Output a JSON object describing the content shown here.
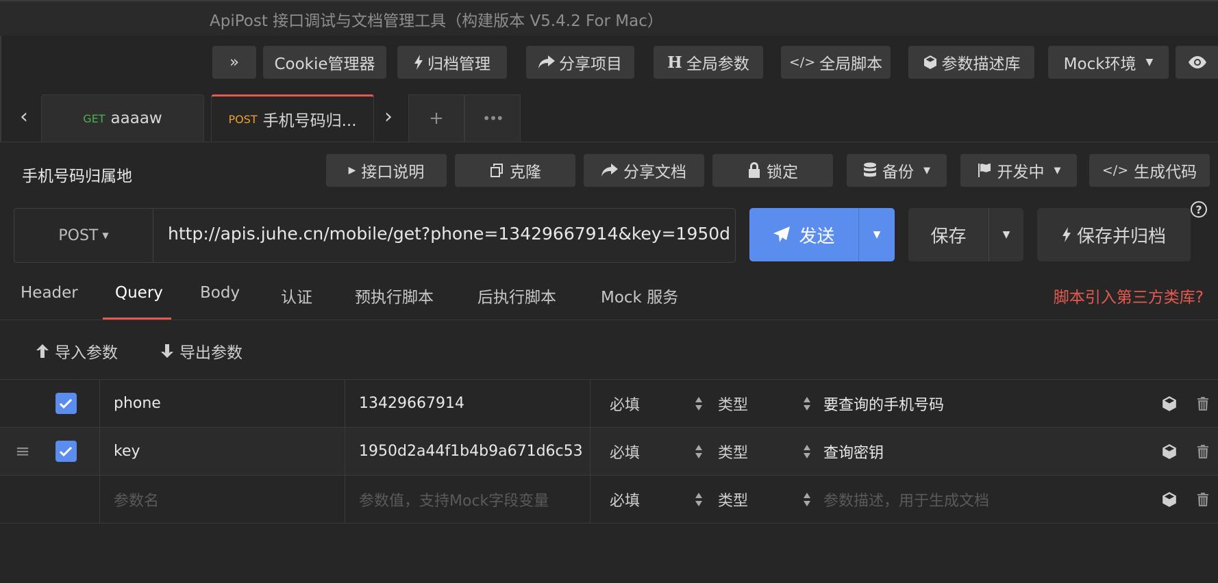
{
  "window": {
    "title": "ApiPost 接口调试与文档管理工具（构建版本 V5.4.2 For Mac）"
  },
  "toolbar": {
    "collapse_label": "»",
    "cookie_label": "Cookie管理器",
    "archive_label": "归档管理",
    "share_project_label": "分享项目",
    "global_params_label": "全局参数",
    "global_script_label": "全局脚本",
    "param_desc_label": "参数描述库",
    "mock_env_label": "Mock环境"
  },
  "tabs": [
    {
      "method": "GET",
      "name": "aaaaw",
      "method_color": "#4caf50"
    },
    {
      "method": "POST",
      "name": "手机号码归...",
      "method_color": "#f0a030"
    }
  ],
  "api": {
    "name": "手机号码归属地",
    "buttons": {
      "doc": "接口说明",
      "clone": "克隆",
      "share_doc": "分享文档",
      "lock": "锁定",
      "backup": "备份",
      "status": "开发中",
      "gen_code": "生成代码"
    }
  },
  "request": {
    "method": "POST",
    "url": "http://apis.juhe.cn/mobile/get?phone=13429667914&key=1950d",
    "send_label": "发送",
    "save_label": "保存",
    "save_archive_label": "保存并归档",
    "help_label": "?"
  },
  "subtabs": {
    "items": [
      "Header",
      "Query",
      "Body",
      "认证",
      "预执行脚本",
      "后执行脚本",
      "Mock 服务"
    ],
    "active": "Query",
    "script_link": "脚本引入第三方类库?"
  },
  "io": {
    "import_label": "导入参数",
    "export_label": "导出参数"
  },
  "params": {
    "rows": [
      {
        "checked": true,
        "name": "phone",
        "value": "13429667914",
        "required": "必填",
        "type": "类型",
        "desc": "要查询的手机号码"
      },
      {
        "checked": true,
        "name": "key",
        "value": "1950d2a44f1b4b9a671d6c53",
        "required": "必填",
        "type": "类型",
        "desc": "查询密钥"
      }
    ],
    "placeholder": {
      "name": "参数名",
      "value": "参数值，支持Mock字段变量",
      "required": "必填",
      "type": "类型",
      "desc": "参数描述，用于生成文档"
    }
  },
  "colors": {
    "accent": "#5b8def",
    "danger": "#e55a4f",
    "background": "#262626"
  }
}
